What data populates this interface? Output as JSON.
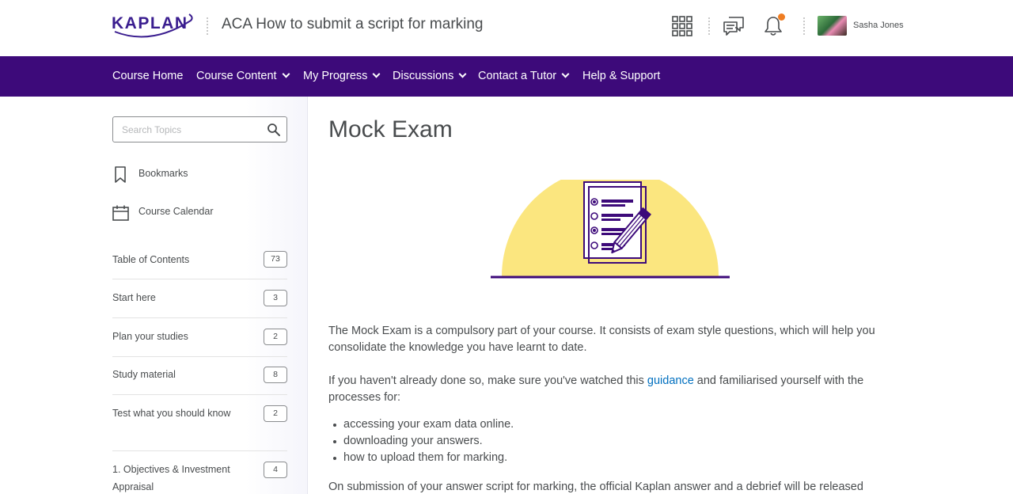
{
  "header": {
    "logo_text": "KAPLAN",
    "course_title": "ACA How to submit a script for marking",
    "user_name": "Sasha Jones",
    "icons": [
      "apps-grid-icon",
      "chat-icon",
      "bell-icon"
    ],
    "accent_color": "#ef7d22"
  },
  "navbar": {
    "background": "#3d0a7a",
    "items": [
      {
        "label": "Course Home",
        "dropdown": false
      },
      {
        "label": "Course Content",
        "dropdown": true
      },
      {
        "label": "My Progress",
        "dropdown": true
      },
      {
        "label": "Discussions",
        "dropdown": true
      },
      {
        "label": "Contact a Tutor",
        "dropdown": true
      },
      {
        "label": "Help & Support",
        "dropdown": false
      }
    ]
  },
  "sidebar": {
    "search_placeholder": "Search Topics",
    "links": [
      {
        "label": "Bookmarks",
        "icon": "bookmark-icon"
      },
      {
        "label": "Course Calendar",
        "icon": "calendar-icon"
      }
    ],
    "toc": [
      {
        "label": "Table of Contents",
        "count": "73"
      },
      {
        "label": "Start here",
        "count": "3"
      },
      {
        "label": "Plan your studies",
        "count": "2"
      },
      {
        "label": "Study material",
        "count": "8"
      },
      {
        "label": "Test what you should know",
        "count": "2"
      },
      {
        "label": "1. Objectives & Investment Appraisal",
        "count": "4"
      }
    ]
  },
  "main": {
    "title": "Mock Exam",
    "para1": "The Mock Exam is a compulsory part of your course. It consists of exam style questions, which will help you consolidate the knowledge you have learnt to date.",
    "para2_before": "If you haven't already done so, make sure you've watched this ",
    "para2_link": "guidance",
    "para2_after": " and familiarised yourself with the processes for:",
    "bullets": [
      "accessing your exam data online.",
      "downloading your answers.",
      "how to upload them for marking."
    ],
    "para3": "On submission of your answer script for marking, the official Kaplan answer and a debrief will be released"
  }
}
